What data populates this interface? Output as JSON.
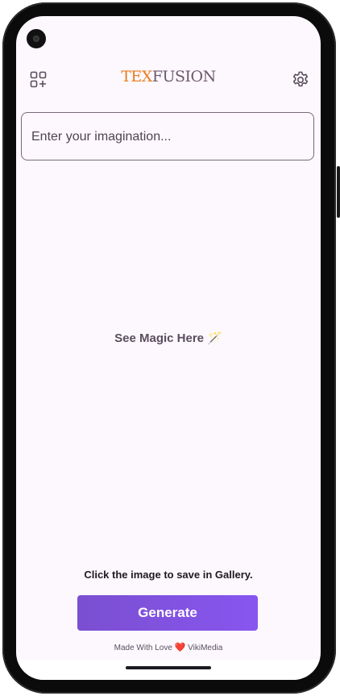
{
  "app": {
    "logo_part1": "TEX",
    "logo_part2": "FUSION"
  },
  "header": {
    "left_icon": "add-widget-icon",
    "right_icon": "gear-icon"
  },
  "prompt": {
    "placeholder": "Enter your imagination...",
    "value": ""
  },
  "main": {
    "magic_text": "See Magic Here",
    "magic_emoji": "🪄",
    "save_hint": "Click the image to save in Gallery."
  },
  "actions": {
    "generate_label": "Generate"
  },
  "footer": {
    "prefix": "Made With Love",
    "heart": "❤️",
    "brand": "VikiMedia"
  },
  "colors": {
    "accent": "#7b4fd0",
    "logo_orange": "#e87d1e",
    "background": "#fdf8fd"
  }
}
